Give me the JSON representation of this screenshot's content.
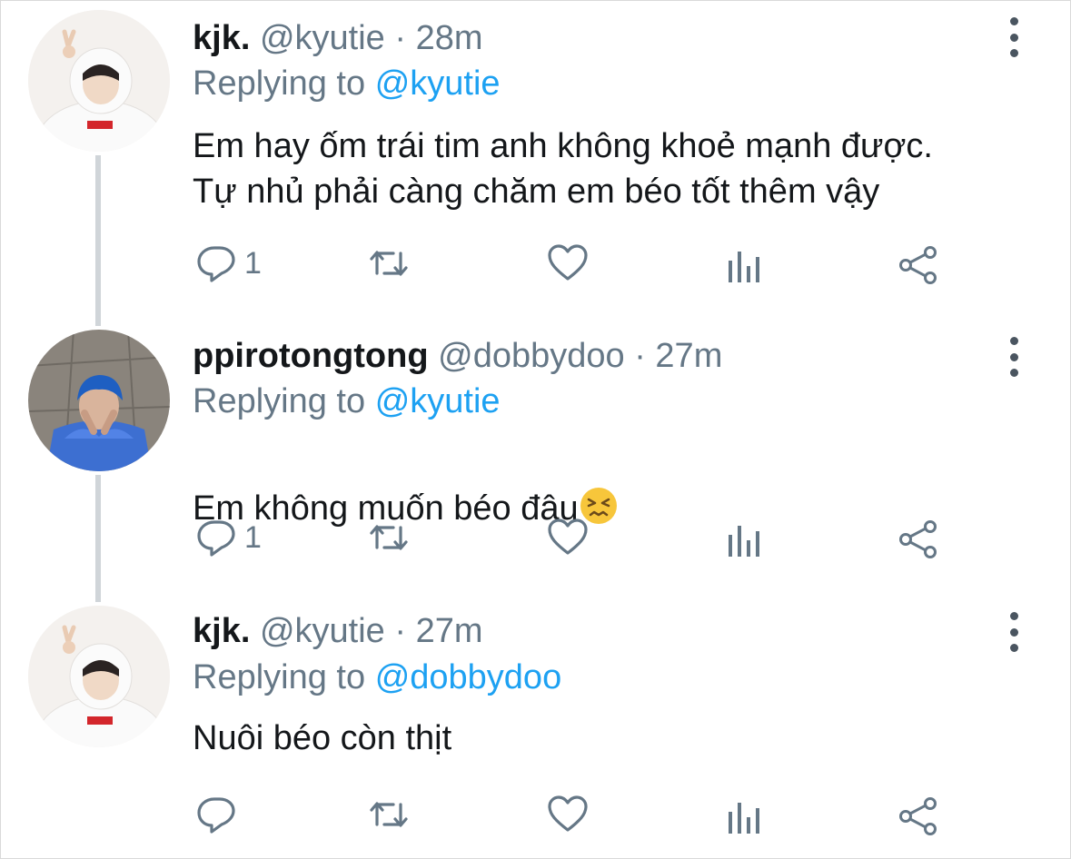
{
  "tweets": [
    {
      "name": "kjk.",
      "handle": "@kyutie",
      "separator": "·",
      "time": "28m",
      "replying_prefix": "Replying to",
      "replying_handle": "@kyutie",
      "text": "Em hay ốm trái tim anh không khoẻ mạnh được.\nTự nhủ phải càng chăm em béo tốt thêm vậy",
      "reply_count": "1",
      "avatar": "avatar-white-hoodie"
    },
    {
      "name": "ppirotongtong",
      "handle": "@dobbydoo",
      "separator": "·",
      "time": "27m",
      "replying_prefix": "Replying to",
      "replying_handle": "@kyutie",
      "text": "Em không muốn béo đâu",
      "emoji": "persevering-face-emoji",
      "reply_count": "1",
      "avatar": "avatar-blue-hair"
    },
    {
      "name": "kjk.",
      "handle": "@kyutie",
      "separator": "·",
      "time": "27m",
      "replying_prefix": "Replying to",
      "replying_handle": "@dobbydoo",
      "text": "Nuôi béo còn thịt",
      "reply_count": "",
      "avatar": "avatar-white-hoodie"
    }
  ],
  "icons": {
    "reply": "reply-icon",
    "retweet": "retweet-icon",
    "like": "heart-icon",
    "analytics": "analytics-icon",
    "share": "share-icon",
    "more": "more-vertical-icon"
  },
  "colors": {
    "link": "#1da1f2",
    "secondary_text": "#657786",
    "primary_text": "#14171a",
    "thread_line": "#d0d5d9"
  }
}
